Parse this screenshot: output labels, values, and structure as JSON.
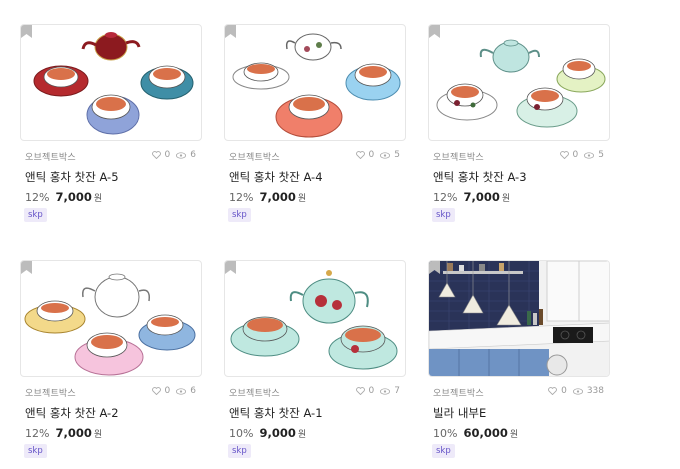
{
  "products": [
    {
      "brand": "오브젝트박스",
      "title": "앤틱 홍차 찻잔 A-5",
      "discount": "12%",
      "price": "7,000",
      "currency": "원",
      "likes": "0",
      "views": "6",
      "tag": "skp",
      "bookmark_icon": "bookmark-icon",
      "image": "teacups-red-blue"
    },
    {
      "brand": "오브젝트박스",
      "title": "앤틱 홍차 찻잔 A-4",
      "discount": "12%",
      "price": "7,000",
      "currency": "원",
      "likes": "0",
      "views": "5",
      "tag": "skp",
      "bookmark_icon": "bookmark-icon",
      "image": "teacups-coral-blue"
    },
    {
      "brand": "오브젝트박스",
      "title": "앤틱 홍차 찻잔 A-3",
      "discount": "12%",
      "price": "7,000",
      "currency": "원",
      "likes": "0",
      "views": "5",
      "tag": "skp",
      "bookmark_icon": "bookmark-icon",
      "image": "teacups-mint-floral"
    },
    {
      "brand": "오브젝트박스",
      "title": "앤틱 홍차 찻잔 A-2",
      "discount": "12%",
      "price": "7,000",
      "currency": "원",
      "likes": "0",
      "views": "6",
      "tag": "skp",
      "bookmark_icon": "bookmark-icon",
      "image": "teacups-gold-pink"
    },
    {
      "brand": "오브젝트박스",
      "title": "앤틱 홍차 찻잔 A-1",
      "discount": "10%",
      "price": "9,000",
      "currency": "원",
      "likes": "0",
      "views": "7",
      "tag": "skp",
      "bookmark_icon": "bookmark-icon",
      "image": "teacups-mint-roses"
    },
    {
      "brand": "오브젝트박스",
      "title": "빌라 내부E",
      "discount": "10%",
      "price": "60,000",
      "currency": "원",
      "likes": "0",
      "views": "338",
      "tag": "skp",
      "bookmark_icon": "bookmark-icon",
      "image": "villa-kitchen"
    }
  ],
  "icons": {
    "likes": "heart-icon",
    "views": "eye-icon"
  },
  "colors": {
    "tag_bg": "#eeeaf9",
    "tag_text": "#6654c8",
    "tea": "#d9714a"
  }
}
